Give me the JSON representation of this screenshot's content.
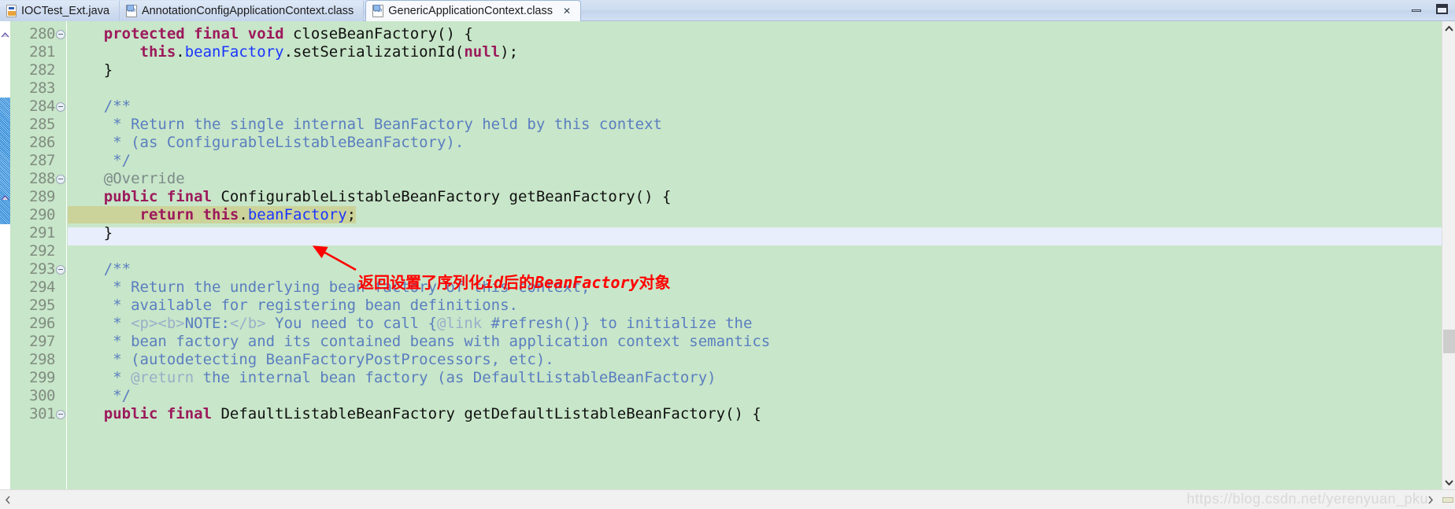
{
  "window": {
    "minimize_label": "Minimize",
    "maximize_label": "Maximize"
  },
  "tabs": [
    {
      "label": "IOCTest_Ext.java",
      "icon": "java-file-icon",
      "active": false,
      "closable": false
    },
    {
      "label": "AnnotationConfigApplicationContext.class",
      "icon": "class-file-icon",
      "active": false,
      "closable": false
    },
    {
      "label": "GenericApplicationContext.class",
      "icon": "class-file-icon",
      "active": true,
      "closable": true,
      "close_glyph": "✕"
    }
  ],
  "editor": {
    "background": "#c8e6c9",
    "current_line_background": "#e8eefb",
    "selection_background": "#ccd39a",
    "first_line_number": 280,
    "lines": [
      {
        "n": 280,
        "fold": true,
        "override": true,
        "change": false,
        "segments": [
          {
            "t": "    ",
            "c": "plain"
          },
          {
            "t": "protected final void ",
            "c": "kw"
          },
          {
            "t": "closeBeanFactory() {",
            "c": "plain"
          }
        ]
      },
      {
        "n": 281,
        "fold": false,
        "override": false,
        "change": false,
        "segments": [
          {
            "t": "        ",
            "c": "plain"
          },
          {
            "t": "this",
            "c": "kw"
          },
          {
            "t": ".",
            "c": "plain"
          },
          {
            "t": "beanFactory",
            "c": "fld"
          },
          {
            "t": ".setSerializationId(",
            "c": "plain"
          },
          {
            "t": "null",
            "c": "kw"
          },
          {
            "t": ");",
            "c": "plain"
          }
        ]
      },
      {
        "n": 282,
        "fold": false,
        "override": false,
        "change": false,
        "segments": [
          {
            "t": "    }",
            "c": "plain"
          }
        ]
      },
      {
        "n": 283,
        "fold": false,
        "override": false,
        "change": false,
        "segments": [
          {
            "t": "",
            "c": "plain"
          }
        ]
      },
      {
        "n": 284,
        "fold": true,
        "override": false,
        "change": true,
        "segments": [
          {
            "t": "    ",
            "c": "plain"
          },
          {
            "t": "/**",
            "c": "cmt"
          }
        ]
      },
      {
        "n": 285,
        "fold": false,
        "override": false,
        "change": true,
        "segments": [
          {
            "t": "     * Return the single internal BeanFactory held by this context",
            "c": "cmt"
          }
        ]
      },
      {
        "n": 286,
        "fold": false,
        "override": false,
        "change": true,
        "segments": [
          {
            "t": "     * (as ConfigurableListableBeanFactory).",
            "c": "cmt"
          }
        ]
      },
      {
        "n": 287,
        "fold": false,
        "override": false,
        "change": true,
        "segments": [
          {
            "t": "     */",
            "c": "cmt"
          }
        ]
      },
      {
        "n": 288,
        "fold": true,
        "override": false,
        "change": true,
        "segments": [
          {
            "t": "    ",
            "c": "plain"
          },
          {
            "t": "@Override",
            "c": "ann"
          }
        ]
      },
      {
        "n": 289,
        "fold": false,
        "override": true,
        "change": true,
        "segments": [
          {
            "t": "    ",
            "c": "plain"
          },
          {
            "t": "public final ",
            "c": "kw"
          },
          {
            "t": "ConfigurableListableBeanFactory getBeanFactory() {",
            "c": "plain"
          }
        ]
      },
      {
        "n": 290,
        "fold": false,
        "override": false,
        "change": true,
        "current": true,
        "selection_end_ch": 33,
        "segments": [
          {
            "t": "        ",
            "c": "plain"
          },
          {
            "t": "return ",
            "c": "kw"
          },
          {
            "t": "this",
            "c": "kw"
          },
          {
            "t": ".",
            "c": "plain"
          },
          {
            "t": "beanFactory",
            "c": "fld"
          },
          {
            "t": ";",
            "c": "plain"
          }
        ]
      },
      {
        "n": 291,
        "fold": false,
        "override": false,
        "change": false,
        "segments": [
          {
            "t": "    }",
            "c": "plain"
          }
        ]
      },
      {
        "n": 292,
        "fold": false,
        "override": false,
        "change": false,
        "segments": [
          {
            "t": "",
            "c": "plain"
          }
        ]
      },
      {
        "n": 293,
        "fold": true,
        "override": false,
        "change": false,
        "segments": [
          {
            "t": "    ",
            "c": "plain"
          },
          {
            "t": "/**",
            "c": "cmt"
          }
        ]
      },
      {
        "n": 294,
        "fold": false,
        "override": false,
        "change": false,
        "segments": [
          {
            "t": "     * Return the underlying bean factory of this context,",
            "c": "cmt"
          }
        ]
      },
      {
        "n": 295,
        "fold": false,
        "override": false,
        "change": false,
        "segments": [
          {
            "t": "     * available for registering bean definitions.",
            "c": "cmt"
          }
        ]
      },
      {
        "n": 296,
        "fold": false,
        "override": false,
        "change": false,
        "segments": [
          {
            "t": "     * ",
            "c": "cmt"
          },
          {
            "t": "<p><b>",
            "c": "cmt-tag"
          },
          {
            "t": "NOTE:",
            "c": "cmt"
          },
          {
            "t": "</b>",
            "c": "cmt-tag"
          },
          {
            "t": " You need to call {",
            "c": "cmt"
          },
          {
            "t": "@link",
            "c": "cmt-tag"
          },
          {
            "t": " #refresh()} to initialize the",
            "c": "cmt"
          }
        ]
      },
      {
        "n": 297,
        "fold": false,
        "override": false,
        "change": false,
        "segments": [
          {
            "t": "     * bean factory and its contained beans with application context semantics",
            "c": "cmt"
          }
        ]
      },
      {
        "n": 298,
        "fold": false,
        "override": false,
        "change": false,
        "segments": [
          {
            "t": "     * (autodetecting BeanFactoryPostProcessors, etc).",
            "c": "cmt"
          }
        ]
      },
      {
        "n": 299,
        "fold": false,
        "override": false,
        "change": false,
        "segments": [
          {
            "t": "     * ",
            "c": "cmt"
          },
          {
            "t": "@return",
            "c": "cmt-tag"
          },
          {
            "t": " the internal bean factory (as DefaultListableBeanFactory)",
            "c": "cmt"
          }
        ]
      },
      {
        "n": 300,
        "fold": false,
        "override": false,
        "change": false,
        "segments": [
          {
            "t": "     */",
            "c": "cmt"
          }
        ]
      },
      {
        "n": 301,
        "fold": true,
        "override": false,
        "change": false,
        "segments": [
          {
            "t": "    ",
            "c": "plain"
          },
          {
            "t": "public final ",
            "c": "kw"
          },
          {
            "t": "DefaultListableBeanFactory getDefaultListableBeanFactory() {",
            "c": "plain"
          }
        ]
      }
    ]
  },
  "annotation": {
    "color": "#fe0000",
    "text_before": "返回设置了序列化",
    "text_italic_1": "id",
    "text_middle": "后的",
    "text_italic_2": "BeanFactory",
    "text_after": "对象",
    "full_text": "返回设置了序列化id后的BeanFactory对象",
    "arrow_label": "red-arrow-pointing-to-return-statement"
  },
  "scrollbars": {
    "vertical": {
      "up_glyph": "⌃",
      "down_glyph": "⌄",
      "thumb_position_pct": 66
    },
    "horizontal": {
      "left_glyph": "‹",
      "right_glyph": "›"
    }
  },
  "watermark": "https://blog.csdn.net/yerenyuan_pku"
}
